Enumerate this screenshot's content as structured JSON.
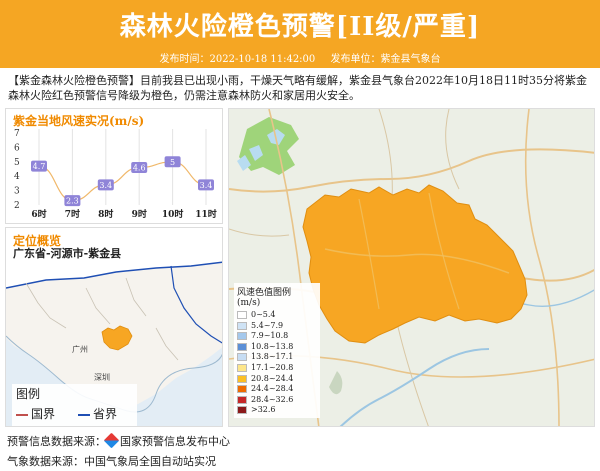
{
  "header": {
    "title": "森林火险橙色预警[II级/严重]",
    "publish_time": "发布时间：2022-10-18 11:42:00",
    "publisher": "发布单位：紫金县气象台"
  },
  "intro": "【紫金森林火险橙色预警】目前我县已出现小雨，干燥天气略有缓解，紫金县气象台2022年10月18日11时35分将紫金森林火险红色预警信号降级为橙色，仍需注意森林防火和家居用火安全。",
  "wind_panel": {
    "title": "紫金当地风速实况(m/s)",
    "y_ticks": [
      "2",
      "3",
      "4",
      "5",
      "6",
      "7"
    ],
    "x_labels": [
      "6时",
      "7时",
      "8时",
      "9时",
      "10时",
      "11时"
    ],
    "point_labels": [
      "4.7",
      "2.3",
      "3.4",
      "4.6",
      "5",
      "3.4"
    ]
  },
  "chart_data": {
    "type": "line",
    "title": "紫金当地风速实况(m/s)",
    "categories": [
      "6时",
      "7时",
      "8时",
      "9时",
      "10时",
      "11时"
    ],
    "series": [
      {
        "values": [
          4.7,
          2.3,
          3.4,
          4.6,
          5,
          3.4
        ]
      }
    ],
    "ylim": [
      2,
      7
    ],
    "grid": "vertical"
  },
  "location_panel": {
    "title": "定位概览",
    "subtitle": "广东省-河源市-紫金县",
    "map_labels": {
      "guangzhou": "广州",
      "shenzhen": "深圳"
    },
    "legend": {
      "title": "图例",
      "items": [
        {
          "label": "国界",
          "color": "#c0504d"
        },
        {
          "label": "省界",
          "color": "#1f4fb4"
        }
      ]
    }
  },
  "wind_legend": {
    "title": "风速色值图例 (m/s)",
    "items": [
      {
        "label": "0~5.4",
        "color": "#ffffff"
      },
      {
        "label": "5.4~7.9",
        "color": "#cfe3f5"
      },
      {
        "label": "7.9~10.8",
        "color": "#a4c8ec"
      },
      {
        "label": "10.8~13.8",
        "color": "#5b8fd6"
      },
      {
        "label": "13.8~17.1",
        "color": "#c7ddf3"
      },
      {
        "label": "17.1~20.8",
        "color": "#fde68a"
      },
      {
        "label": "20.8~24.4",
        "color": "#fbbf24"
      },
      {
        "label": "24.4~28.4",
        "color": "#ef6c00"
      },
      {
        "label": "28.4~32.6",
        "color": "#c62828"
      },
      {
        "label": ">32.6",
        "color": "#8b1a1a"
      }
    ]
  },
  "colors": {
    "header_bg": "#f5a623",
    "accent": "#f08a00",
    "warning_area": "#f7a623"
  },
  "sources": {
    "warning_label": "预警信息数据来源：",
    "warning_value": "国家预警信息发布中心",
    "weather": "气象数据来源：中国气象局全国自动站实况"
  }
}
